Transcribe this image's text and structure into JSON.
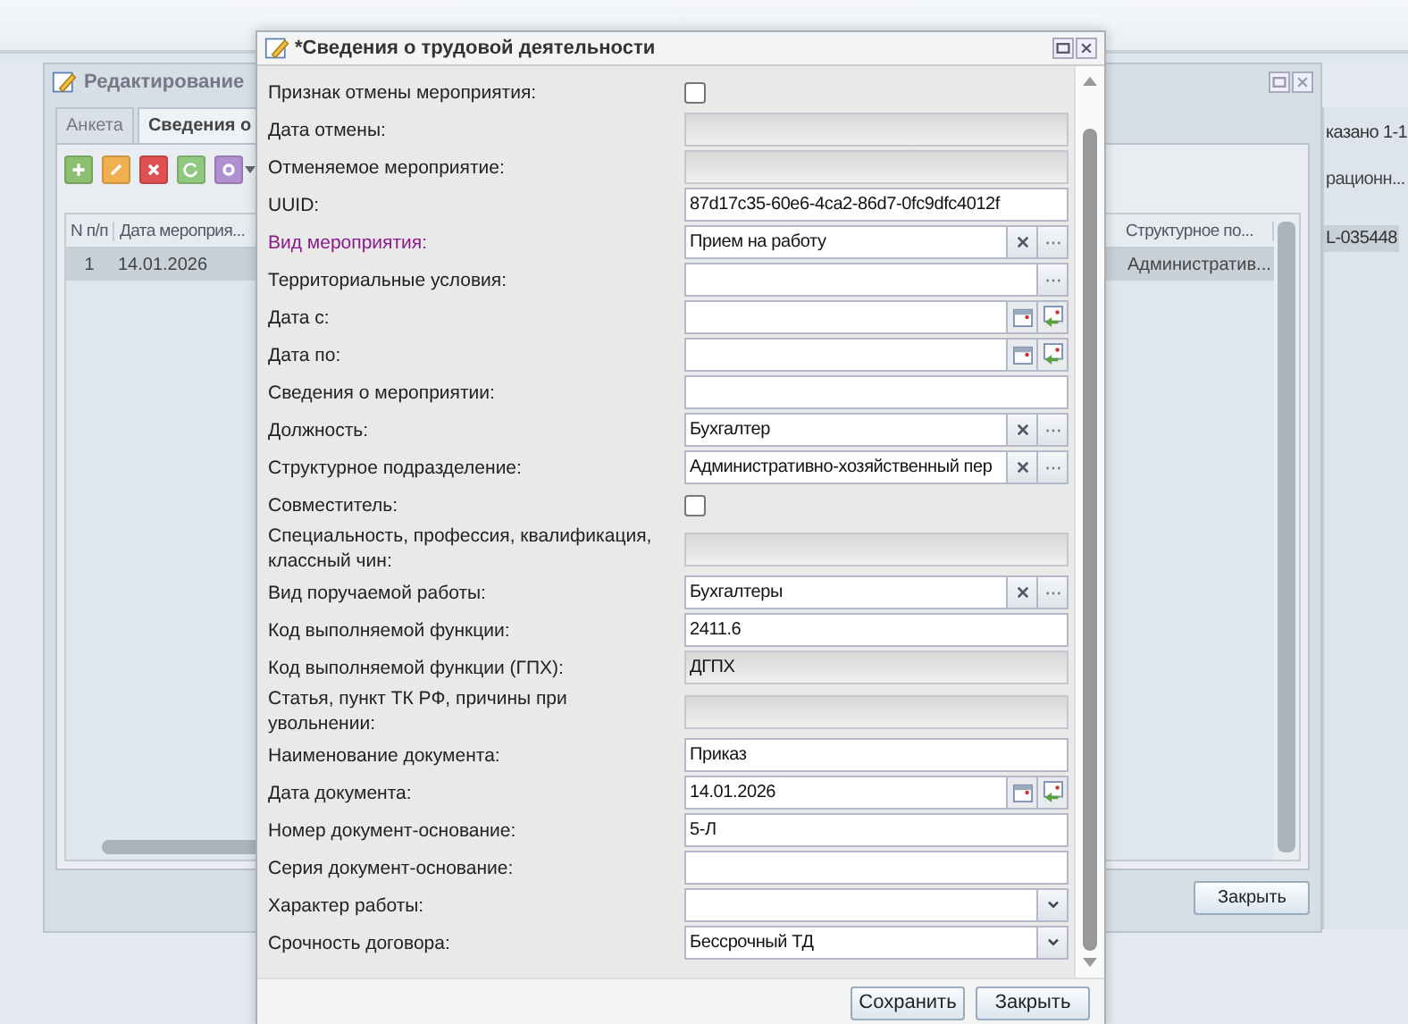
{
  "background_window": {
    "title": "Редактирование",
    "tabs": [
      {
        "label": "Анкета",
        "selected": false
      },
      {
        "label": "Сведения о",
        "selected": true
      }
    ],
    "grid": {
      "columns": [
        "N п/п",
        "Дата мероприя...",
        "Структурное по..."
      ],
      "rows": [
        {
          "cells": [
            "1",
            "14.01.2026",
            "Административ..."
          ],
          "selected": true
        }
      ]
    },
    "close_button": "Закрыть"
  },
  "side_panel": {
    "paging": "казано 1-1",
    "column_header": "рационн...",
    "cell": "L-035448"
  },
  "dialog": {
    "title": "*Сведения о трудовой деятельности",
    "fields": [
      {
        "label": "Признак отмены мероприятия:",
        "kind": "checkbox",
        "checked": false,
        "required": false
      },
      {
        "label": "Дата отмены:",
        "kind": "text",
        "readonly": true,
        "required": false
      },
      {
        "label": "Отменяемое мероприятие:",
        "kind": "text",
        "readonly": true,
        "required": false
      },
      {
        "label": "UUID:",
        "kind": "text",
        "value": "87d17c35-60e6-4ca2-86d7-0fc9dfc4012f",
        "readonly": false,
        "required": false
      },
      {
        "label": "Вид мероприятия:",
        "kind": "lookup",
        "value": "Прием на работу",
        "clearable": true,
        "required": true
      },
      {
        "label": "Территориальные условия:",
        "kind": "lookup",
        "clearable": false,
        "required": false
      },
      {
        "label": "Дата с:",
        "kind": "date",
        "required": false
      },
      {
        "label": "Дата по:",
        "kind": "date",
        "required": false
      },
      {
        "label": "Сведения о мероприятии:",
        "kind": "text",
        "readonly": false,
        "required": false
      },
      {
        "label": "Должность:",
        "kind": "lookup",
        "value": "Бухгалтер",
        "clearable": true,
        "required": false
      },
      {
        "label": "Структурное подразделение:",
        "kind": "lookup",
        "value": "Административно-хозяйственный пер",
        "clearable": true,
        "required": false
      },
      {
        "label": "Совместитель:",
        "kind": "checkbox",
        "checked": false,
        "required": false
      },
      {
        "label": "Специальность, профессия, квалификация, классный чин:",
        "kind": "text",
        "readonly": true,
        "required": false
      },
      {
        "label": "Вид поручаемой работы:",
        "kind": "lookup",
        "value": "Бухгалтеры",
        "clearable": true,
        "required": false
      },
      {
        "label": "Код выполняемой функции:",
        "kind": "text",
        "value": "2411.6",
        "readonly": false,
        "required": false
      },
      {
        "label": "Код выполняемой функции (ГПХ):",
        "kind": "text",
        "value": "ДГПХ",
        "readonly": true,
        "required": false
      },
      {
        "label": "Статья, пункт ТК РФ, причины при увольнении:",
        "kind": "text",
        "readonly": true,
        "required": false
      },
      {
        "label": "Наименование документа:",
        "kind": "text",
        "value": "Приказ",
        "readonly": false,
        "required": false
      },
      {
        "label": "Дата документа:",
        "kind": "date",
        "value": "14.01.2026",
        "required": false
      },
      {
        "label": "Номер документ-основание:",
        "kind": "text",
        "value": "5-Л",
        "readonly": false,
        "required": false
      },
      {
        "label": "Серия документ-основание:",
        "kind": "text",
        "readonly": false,
        "required": false
      },
      {
        "label": "Характер работы:",
        "kind": "combo",
        "required": false
      },
      {
        "label": "Срочность договора:",
        "kind": "combo",
        "value": "Бессрочный ТД",
        "required": false
      }
    ],
    "buttons": [
      "Сохранить",
      "Закрыть"
    ]
  }
}
